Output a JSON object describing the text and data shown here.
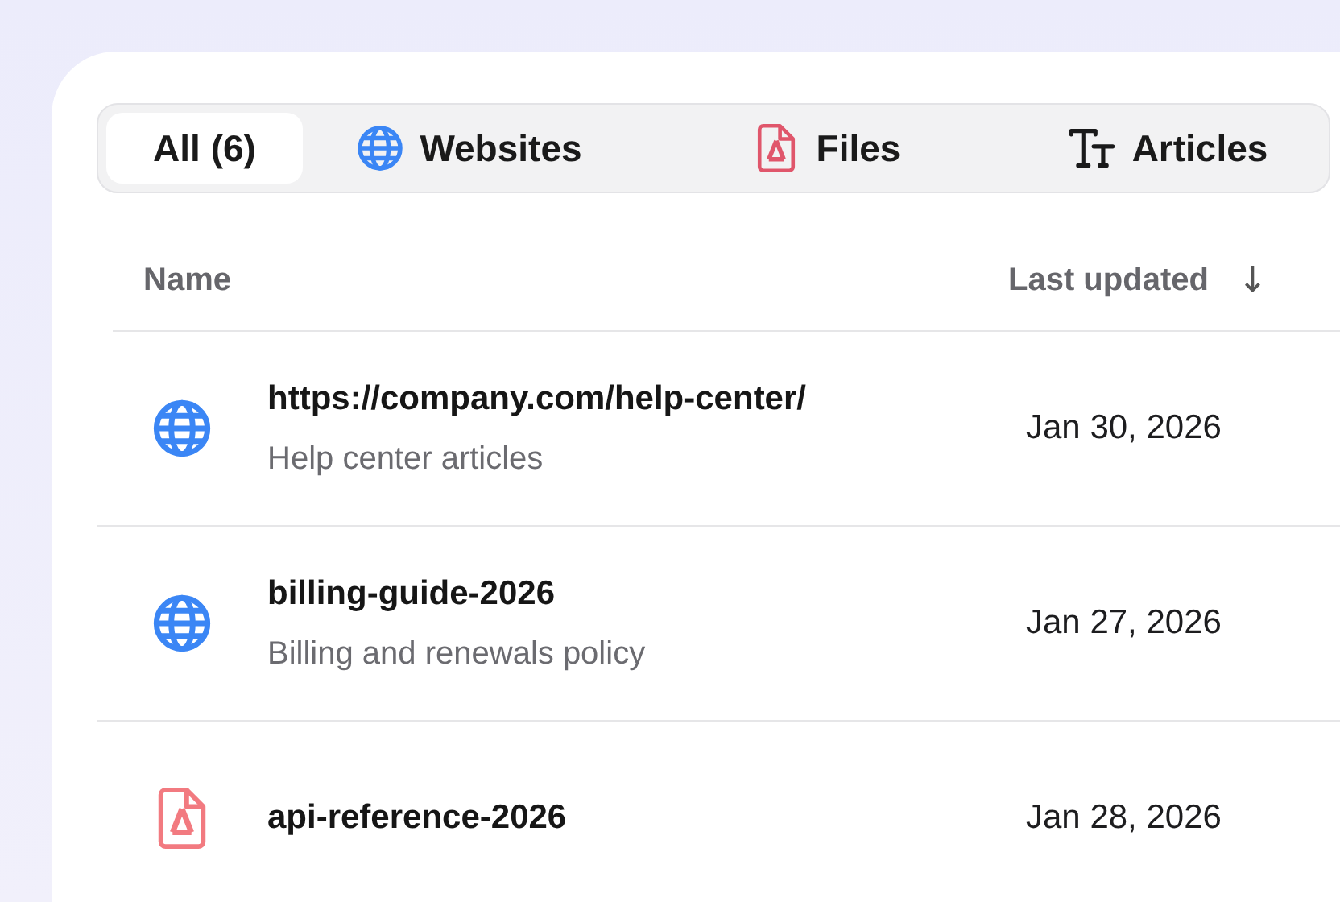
{
  "tabs": [
    {
      "label": "All (6)",
      "kind": "all",
      "selected": true
    },
    {
      "label": "Websites",
      "kind": "website",
      "selected": false
    },
    {
      "label": "Files",
      "kind": "file",
      "selected": false
    },
    {
      "label": "Articles",
      "kind": "article",
      "selected": false
    }
  ],
  "table": {
    "columns": [
      {
        "label": "Name"
      },
      {
        "label": "Last updated",
        "sort_arrow": "↓"
      }
    ],
    "rows": [
      {
        "kind": "website",
        "title": "https://company.com/help-center/",
        "subtitle": "Help center articles",
        "date": "Jan 30, 2026"
      },
      {
        "kind": "website",
        "title": "billing-guide-2026",
        "subtitle": "Billing and renewals policy",
        "date": "Jan 27, 2026"
      },
      {
        "kind": "file",
        "title": "api-reference-2026",
        "date": "Jan 28, 2026"
      }
    ]
  }
}
